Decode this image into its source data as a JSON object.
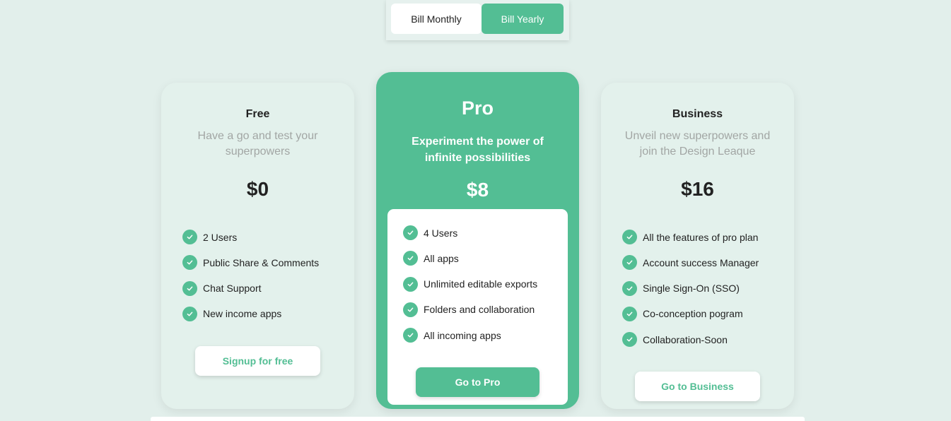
{
  "billing_toggle": {
    "monthly_label": "Bill Monthly",
    "yearly_label": "Bill Yearly",
    "selected": "yearly"
  },
  "colors": {
    "accent": "#53be94",
    "background": "#e2efeb",
    "card": "#e3f1ec",
    "muted_text": "#a2a6a4"
  },
  "plans": [
    {
      "name": "Free",
      "description": "Have a go and test your superpowers",
      "price": "$0",
      "features": [
        "2 Users",
        "Public Share & Comments",
        "Chat Support",
        "New income apps"
      ],
      "cta": "Signup for free"
    },
    {
      "name": "Pro",
      "description": "Experiment the power of infinite possibilities",
      "price": "$8",
      "features": [
        "4 Users",
        "All apps",
        "Unlimited editable exports",
        "Folders and collaboration",
        "All incoming apps"
      ],
      "cta": "Go to Pro"
    },
    {
      "name": "Business",
      "description": "Unveil new superpowers and join the Design Leaque",
      "price": "$16",
      "features": [
        "All the features of pro plan",
        "Account success Manager",
        "Single Sign-On (SSO)",
        "Co-conception pogram",
        "Collaboration-Soon"
      ],
      "cta": "Go to Business"
    }
  ],
  "icons": {
    "feature_check": "check-icon"
  }
}
